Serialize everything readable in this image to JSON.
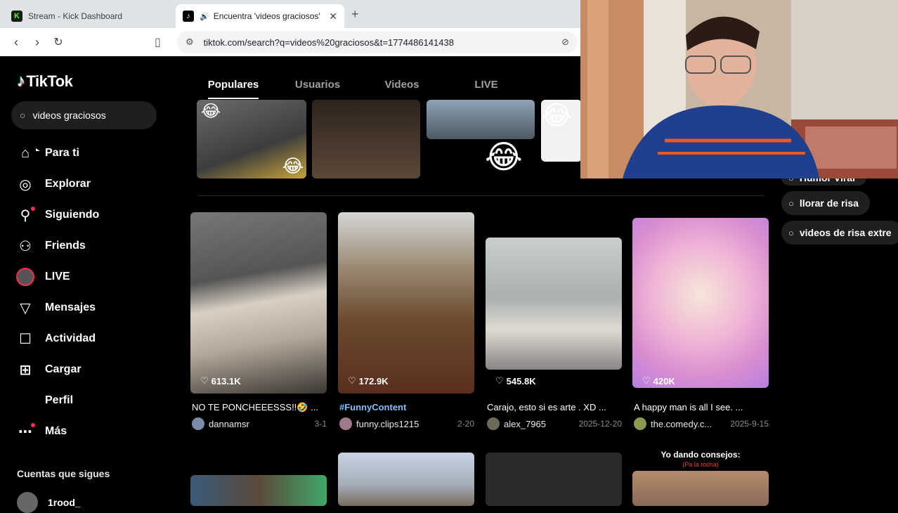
{
  "browser": {
    "tabs": [
      {
        "favicon": "K",
        "title": "Stream - Kick Dashboard",
        "active": false
      },
      {
        "favicon": "♪",
        "title": "Encuentra 'videos graciosos'",
        "active": true
      }
    ],
    "url": "tiktok.com/search?q=videos%20graciosos&t=1774486141438"
  },
  "tiktok": {
    "logo": "TikTok",
    "search_value": "videos graciosos",
    "nav": [
      {
        "label": "Para ti",
        "icon": "home-icon"
      },
      {
        "label": "Explorar",
        "icon": "compass-icon"
      },
      {
        "label": "Siguiendo",
        "icon": "following-icon"
      },
      {
        "label": "Friends",
        "icon": "friends-icon"
      },
      {
        "label": "LIVE",
        "icon": "live-icon"
      },
      {
        "label": "Mensajes",
        "icon": "messages-icon"
      },
      {
        "label": "Actividad",
        "icon": "activity-icon"
      },
      {
        "label": "Cargar",
        "icon": "upload-icon"
      },
      {
        "label": "Perfil",
        "icon": "profile-icon"
      },
      {
        "label": "Más",
        "icon": "more-icon"
      }
    ],
    "following_title": "Cuentas que sigues",
    "following_user": "1rood_",
    "search_tabs": [
      "Populares",
      "Usuarios",
      "Videos",
      "LIVE"
    ],
    "related": [
      "Humor Viral",
      "llorar de risa",
      "videos de risa extre"
    ],
    "videos": [
      {
        "likes": "613.1K",
        "caption": "NO TE PONCHEEESSS!!🤣 ...",
        "user": "dannamsr",
        "date": "3-1",
        "hashtag": false
      },
      {
        "likes": "172.9K",
        "caption": "#FunnyContent",
        "user": "funny.clips1215",
        "date": "2-20",
        "hashtag": true
      },
      {
        "likes": "545.8K",
        "caption": "Carajo, esto si es arte . XD ...",
        "user": "alex_7965",
        "date": "2025-12-20",
        "hashtag": false
      },
      {
        "likes": "420K",
        "caption": "A happy man is all I see. ...",
        "user": "the.comedy.c...",
        "date": "2025-9-15",
        "hashtag": false
      }
    ],
    "bottom_overlay_text": "Yo dando consejos:",
    "bottom_overlay_sub": "(Pa la rocha)",
    "colors": {
      "accent": "#fe2c55",
      "cyan": "#25f4ee",
      "background": "#000000"
    }
  }
}
